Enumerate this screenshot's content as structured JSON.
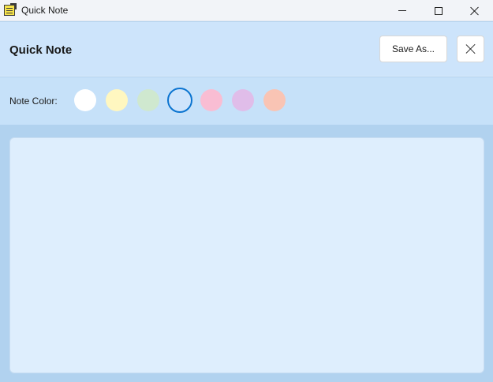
{
  "window": {
    "title": "Quick Note",
    "app_icon": "notepad-icon",
    "controls": [
      "minimize-icon",
      "maximize-icon",
      "close-icon"
    ]
  },
  "header": {
    "title": "Quick Note",
    "save_label": "Save As...",
    "close_icon": "close-icon"
  },
  "note_color": {
    "label": "Note Color:",
    "swatches": [
      "#ffffff",
      "#fff7c0",
      "#cfe8cf",
      "#cfe4fb",
      "#f9bdd3",
      "#e0bde9",
      "#f9c4b4"
    ],
    "selected_index": 3,
    "selected_outline": "#0b74d0"
  },
  "editor": {
    "value": "",
    "background": "#deeefd"
  }
}
